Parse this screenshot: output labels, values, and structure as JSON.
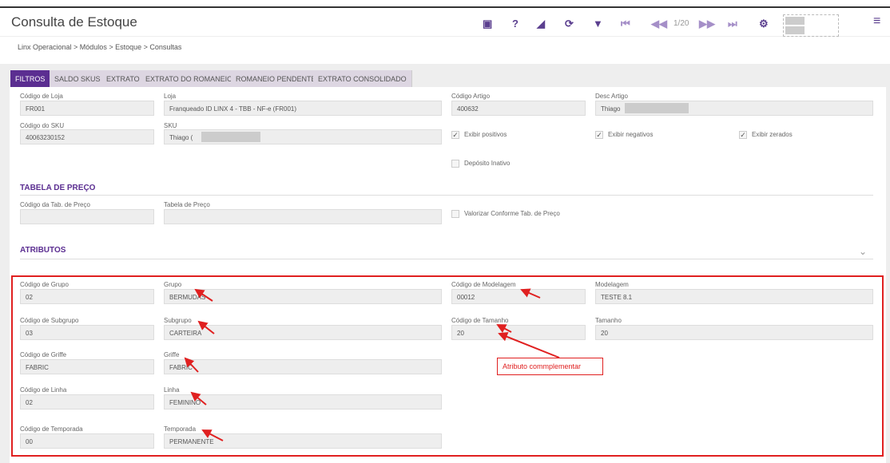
{
  "header": {
    "title": "Consulta de Estoque",
    "pager": "1/20",
    "icons": [
      "youtube-icon",
      "help-icon",
      "eraser-icon",
      "refresh-icon",
      "filter-icon",
      "first-page-icon",
      "previous-page-icon",
      "next-page-icon",
      "last-page-icon",
      "gear-icon",
      "menu-icon"
    ]
  },
  "breadcrumb": "Linx Operacional  >  Módulos  >  Estoque  >  Consultas",
  "tabs": [
    "FILTROS",
    "SALDO SKUS",
    "EXTRATO",
    "EXTRATO DO ROMANEIO",
    "ROMANEIO PENDENTE",
    "EXTRATO CONSOLIDADO"
  ],
  "filters": {
    "codigo_loja": {
      "label": "Código de Loja",
      "value": "FR001"
    },
    "loja": {
      "label": "Loja",
      "value": "Franqueado ID LINX 4 - TBB - NF-e (FR001)"
    },
    "codigo_artigo": {
      "label": "Código Artigo",
      "value": "400632"
    },
    "desc_artigo": {
      "label": "Desc Artigo",
      "value": "Thiago"
    },
    "codigo_sku": {
      "label": "Código do SKU",
      "value": "40063230152"
    },
    "sku": {
      "label": "SKU",
      "value": "Thiago ("
    },
    "exibir_positivos": "Exibir positivos",
    "exibir_negativos": "Exibir negativos",
    "exibir_zerados": "Exibir zerados",
    "deposito_inativo": "Depósito Inativo"
  },
  "tabela_preco": {
    "title": "TABELA DE PREÇO",
    "codigo_label": "Código da Tab. de Preço",
    "tabela_label": "Tabela de Preço",
    "valorizar": "Valorizar Conforme Tab. de Preço"
  },
  "atributos": {
    "title": "ATRIBUTOS",
    "rows": [
      [
        {
          "label": "Código de Grupo",
          "value": "02"
        },
        {
          "label": "Grupo",
          "value": "BERMUDAS"
        },
        {
          "label": "Código de Modelagem",
          "value": "00012"
        },
        {
          "label": "Modelagem",
          "value": "TESTE 8.1"
        }
      ],
      [
        {
          "label": "Código de Subgrupo",
          "value": "03"
        },
        {
          "label": "Subgrupo",
          "value": "CARTEIRA"
        },
        {
          "label": "Código de Tamanho",
          "value": "20"
        },
        {
          "label": "Tamanho",
          "value": "20"
        }
      ],
      [
        {
          "label": "Código de Griffe",
          "value": "FABRIC"
        },
        {
          "label": "Griffe",
          "value": "FABRIC"
        }
      ],
      [
        {
          "label": "Código de Linha",
          "value": "02"
        },
        {
          "label": "Linha",
          "value": "FEMININO"
        }
      ],
      [
        {
          "label": "Código de Temporada",
          "value": "00"
        },
        {
          "label": "Temporada",
          "value": "PERMANENTE"
        }
      ]
    ]
  },
  "annotation": "Atributo commplementar"
}
